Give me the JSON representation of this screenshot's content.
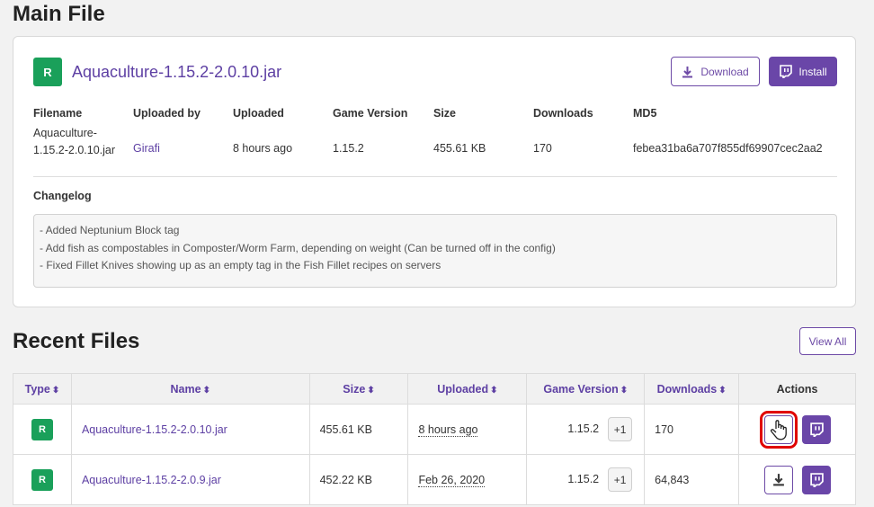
{
  "main": {
    "heading": "Main File",
    "badge": "R",
    "file_name": "Aquaculture-1.15.2-2.0.10.jar",
    "download_label": "Download",
    "install_label": "Install",
    "headers": {
      "filename": "Filename",
      "uploaded_by": "Uploaded by",
      "uploaded": "Uploaded",
      "game_version": "Game Version",
      "size": "Size",
      "downloads": "Downloads",
      "md5": "MD5"
    },
    "values": {
      "filename_line1": "Aquaculture-",
      "filename_line2": "1.15.2-2.0.10.jar",
      "uploaded_by": "Girafi",
      "uploaded": "8 hours ago",
      "game_version": "1.15.2",
      "size": "455.61 KB",
      "downloads": "170",
      "md5": "febea31ba6a707f855df69907cec2aa2"
    },
    "changelog_label": "Changelog",
    "changelog": [
      "- Added Neptunium Block tag",
      "- Add fish as compostables in Composter/Worm Farm, depending on weight (Can be turned off in the config)",
      "- Fixed Fillet Knives showing up as an empty tag in the Fish Fillet recipes on servers"
    ]
  },
  "recent": {
    "heading": "Recent Files",
    "view_all": "View All",
    "columns": {
      "type": "Type",
      "name": "Name",
      "size": "Size",
      "uploaded": "Uploaded",
      "game_version": "Game Version",
      "downloads": "Downloads",
      "actions": "Actions"
    },
    "rows": [
      {
        "type": "R",
        "name": "Aquaculture-1.15.2-2.0.10.jar",
        "size": "455.61 KB",
        "uploaded": "8 hours ago",
        "game_version": "1.15.2",
        "more_versions": "+1",
        "downloads": "170"
      },
      {
        "type": "R",
        "name": "Aquaculture-1.15.2-2.0.9.jar",
        "size": "452.22 KB",
        "uploaded": "Feb 26, 2020",
        "game_version": "1.15.2",
        "more_versions": "+1",
        "downloads": "64,843"
      }
    ]
  },
  "colors": {
    "accent": "#6a46a8",
    "release_badge": "#1aa05a",
    "highlight": "#e00000"
  },
  "icons": [
    "download-icon",
    "twitch-icon",
    "hand-cursor-icon",
    "sort-icon"
  ]
}
